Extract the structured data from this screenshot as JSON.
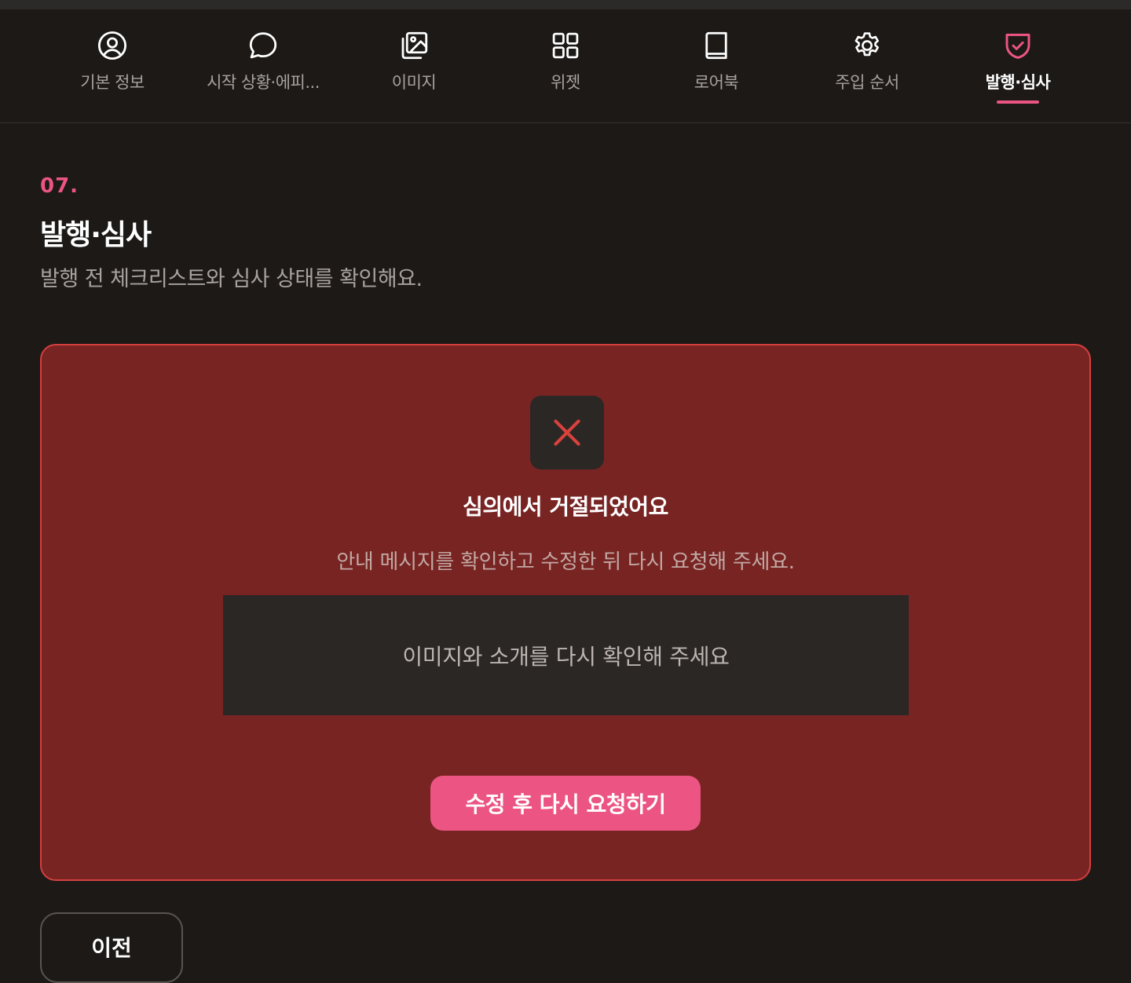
{
  "tabs": [
    {
      "label": "기본 정보",
      "icon": "user-circle-icon",
      "active": false
    },
    {
      "label": "시작 상황·에피...",
      "icon": "chat-bubble-icon",
      "active": false
    },
    {
      "label": "이미지",
      "icon": "images-icon",
      "active": false
    },
    {
      "label": "위젯",
      "icon": "grid-icon",
      "active": false
    },
    {
      "label": "로어북",
      "icon": "book-icon",
      "active": false
    },
    {
      "label": "주입 순서",
      "icon": "gear-icon",
      "active": false
    },
    {
      "label": "발행·심사",
      "icon": "shield-check-icon",
      "active": true
    }
  ],
  "section": {
    "number": "07.",
    "title": "발행·심사",
    "subtitle": "발행 전 체크리스트와 심사 상태를 확인해요."
  },
  "status_panel": {
    "icon": "x-icon",
    "title": "심의에서 거절되었어요",
    "description": "안내 메시지를 확인하고 수정한 뒤 다시 요청해 주세요.",
    "message": "이미지와 소개를 다시 확인해 주세요",
    "button_label": "수정 후 다시 요청하기"
  },
  "footer": {
    "prev_label": "이전"
  },
  "colors": {
    "accent": "#ec5583",
    "background": "#1c1917",
    "panel_bg": "#772423",
    "panel_border": "#d4403e",
    "error_icon": "#d9423c"
  }
}
